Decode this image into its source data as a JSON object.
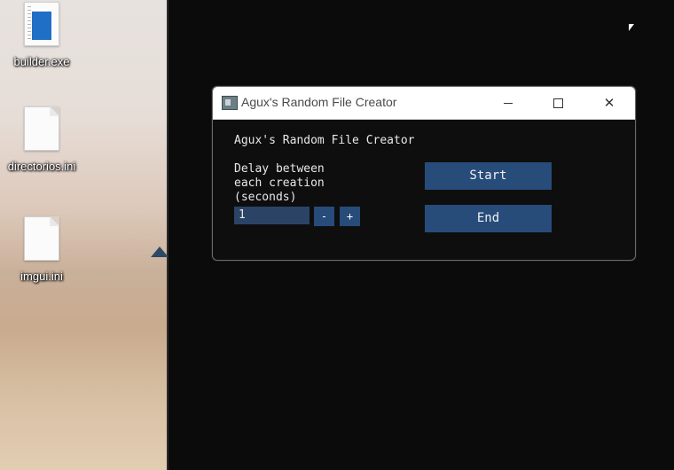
{
  "desktop": {
    "icons": [
      {
        "label": "builder.exe",
        "icon": "exe-file-icon"
      },
      {
        "label": "directorios.ini",
        "icon": "ini-file-icon"
      },
      {
        "label": "imgui.ini",
        "icon": "ini-file-icon"
      }
    ]
  },
  "window": {
    "title": "Agux's Random File Creator",
    "heading": "Agux's Random File Creator",
    "delay_label": [
      "Delay between",
      "each creation",
      "(seconds)"
    ],
    "delay_value": "1",
    "minus_label": "-",
    "plus_label": "+",
    "start_label": "Start",
    "end_label": "End",
    "controls": {
      "minimize": "minimize-icon",
      "maximize": "maximize-icon",
      "close": "close-icon"
    }
  },
  "colors": {
    "accent_button": "#274c7a",
    "input_bg": "#2b4466",
    "window_bg": "#0e0e0f",
    "text": "#e8e8e8"
  }
}
